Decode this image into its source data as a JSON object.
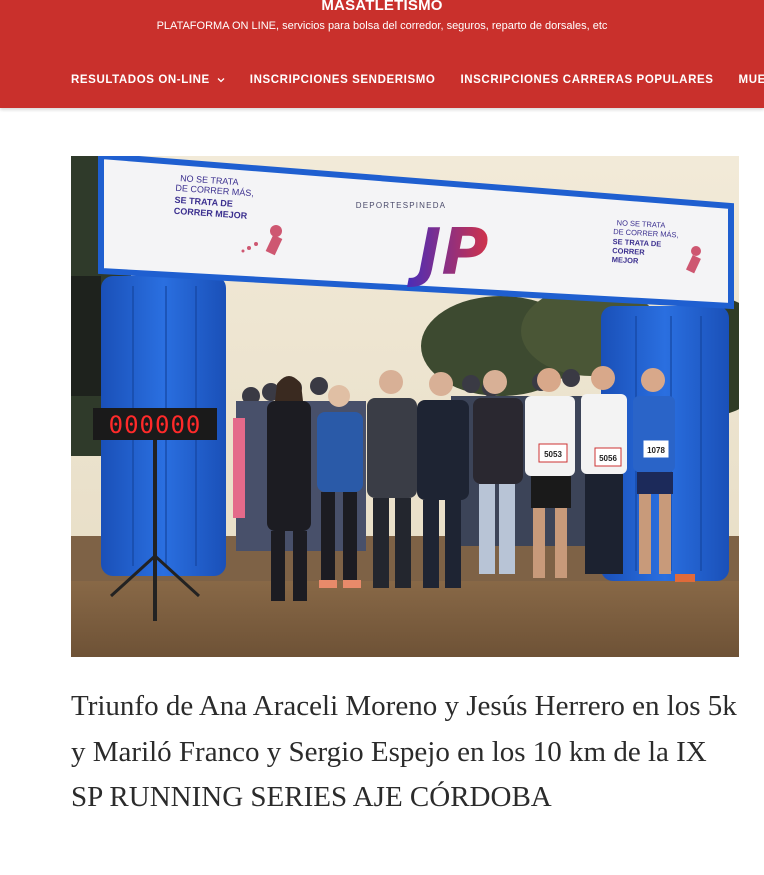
{
  "site": {
    "title": "MASATLETISMO",
    "tagline": "PLATAFORMA ON LINE, servicios para bolsa del corredor, seguros, reparto de dorsales, etc"
  },
  "nav": {
    "items": [
      {
        "label": "RESULTADOS ON-LINE",
        "has_dropdown": true
      },
      {
        "label": "INSCRIPCIONES SENDERISMO"
      },
      {
        "label": "INSCRIPCIONES CARRERAS POPULARES"
      },
      {
        "label": "MUEST"
      }
    ]
  },
  "photo": {
    "arch_slogan_left": [
      "NO SE TRATA",
      "DE CORRER MÁS,",
      "SE TRATA DE",
      "CORRER MEJOR"
    ],
    "arch_slogan_right": [
      "NO SE TRATA",
      "DE CORRER MÁS,",
      "SE TRATA DE",
      "CORRER",
      "MEJOR"
    ],
    "arch_brand": "DEPORTESPINEDA",
    "arch_logo": "JP",
    "timer": "000000",
    "bibs": [
      "5053",
      "5056",
      "1078"
    ]
  },
  "post": {
    "title": "Triunfo de Ana Araceli Moreno y Jesús Herrero en los 5k y Mariló Franco y Sergio Espejo en los 10 km de la IX SP RUNNING SERIES AJE CÓRDOBA"
  },
  "colors": {
    "header_bg": "#c9302c",
    "arch_blue": "#1f5fd0",
    "brand_purple": "#5a2ab0",
    "brand_red": "#d0324a"
  }
}
